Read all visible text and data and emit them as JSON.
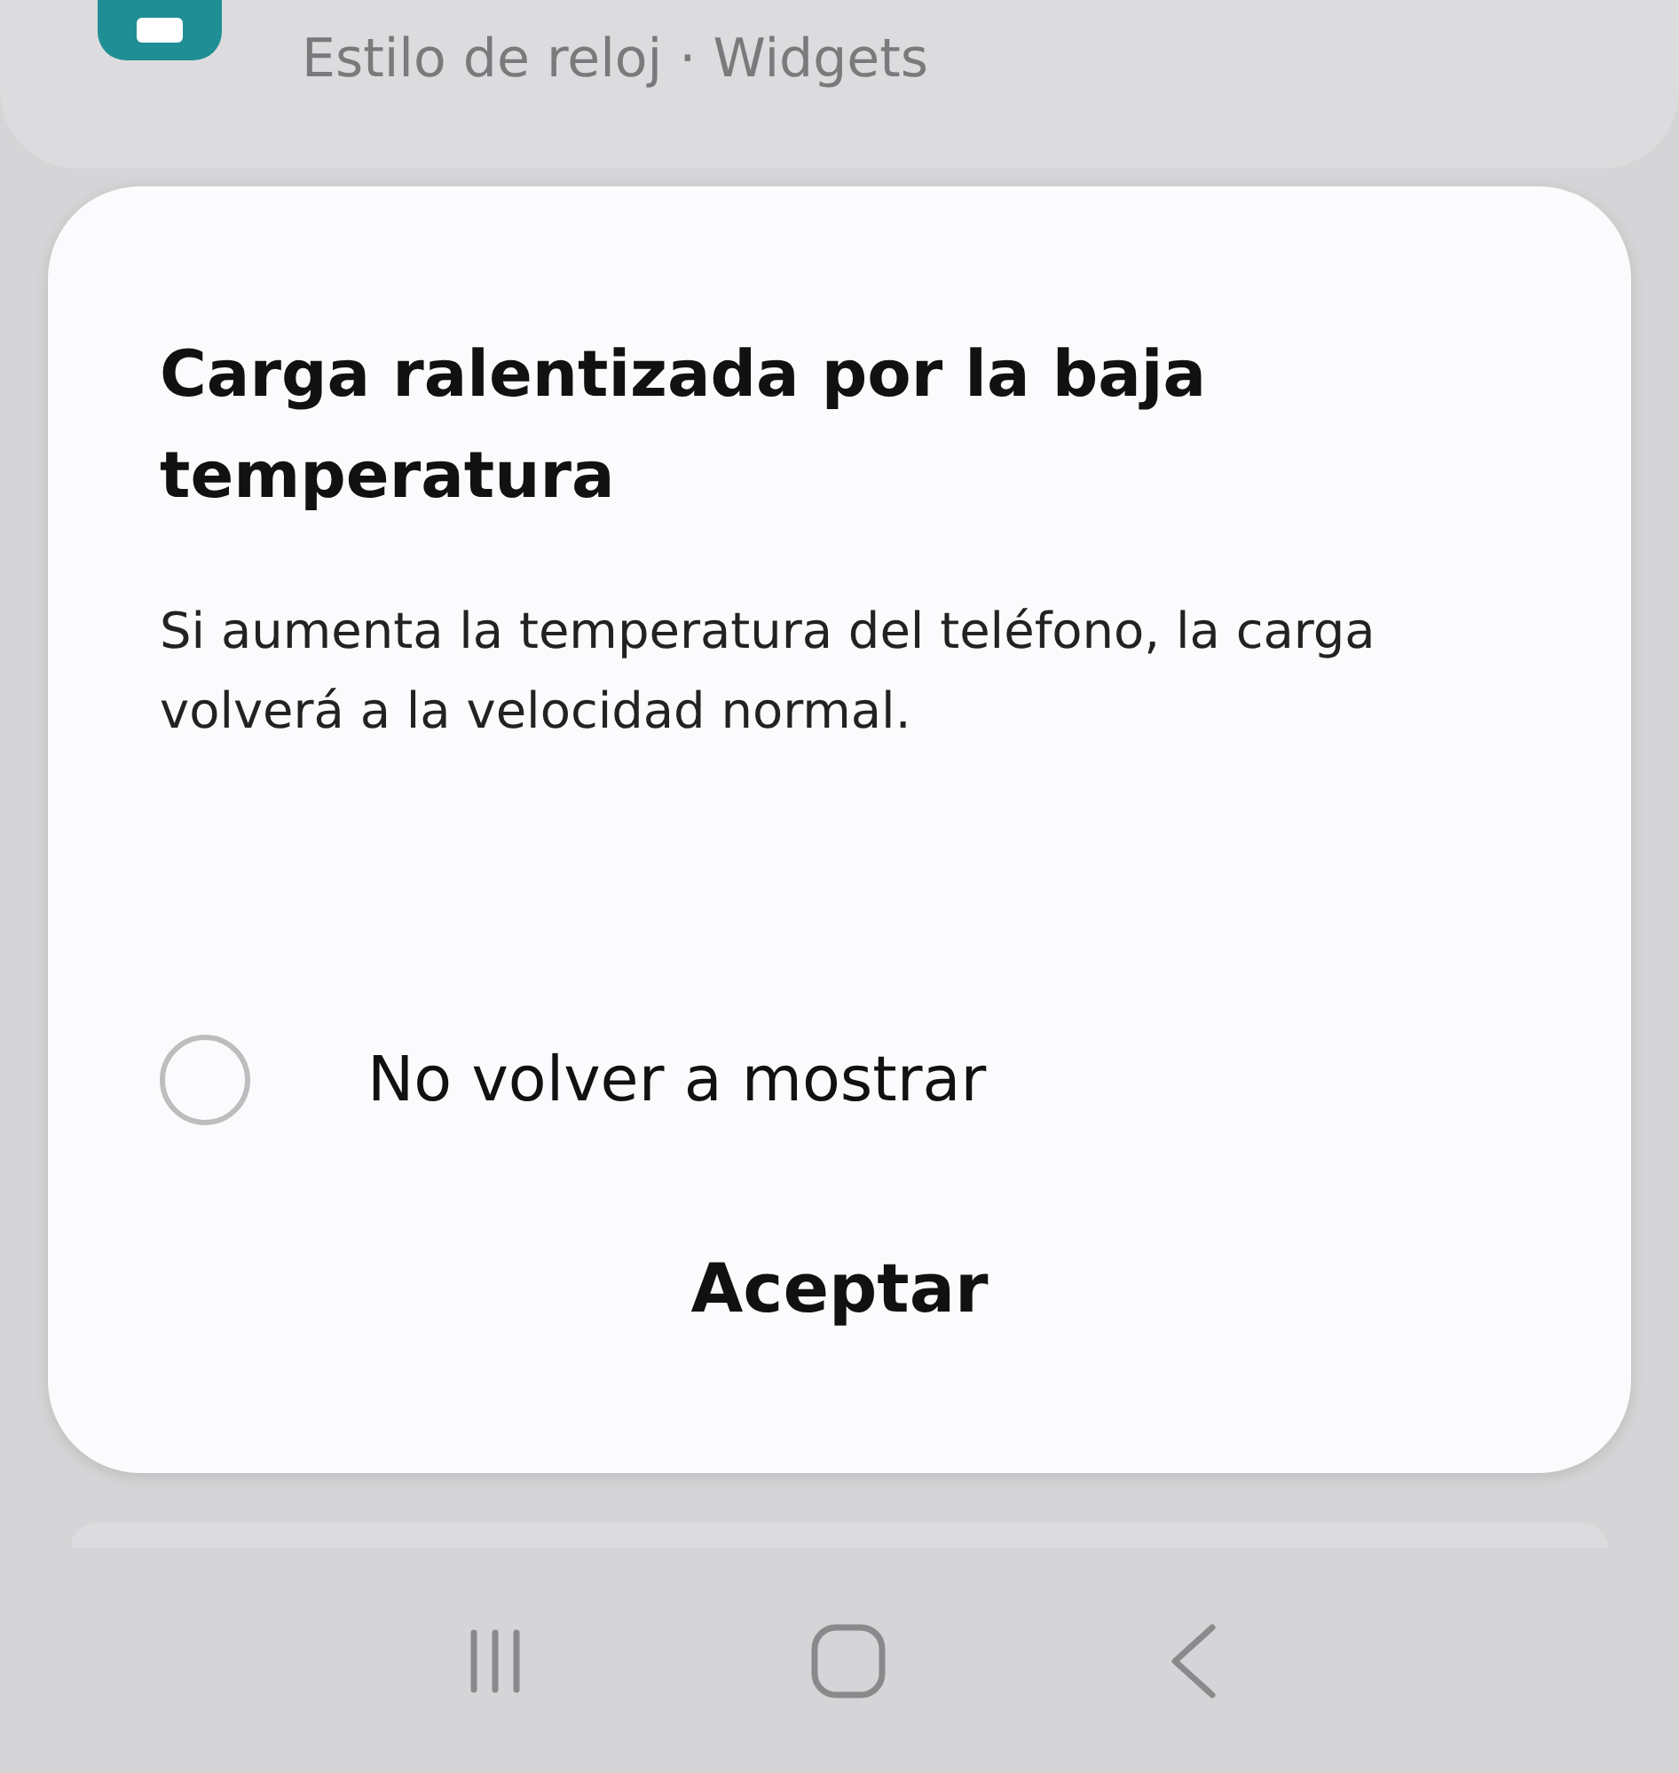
{
  "top_card": {
    "subtitle": "Estilo de reloj · Widgets"
  },
  "dialog": {
    "title": "Carga ralentizada por la baja temperatura",
    "message": "Si aumenta la temperatura del teléfono, la carga volverá a la velocidad normal.",
    "option": {
      "label": "No volver a mostrar",
      "checked": false
    },
    "button": "Aceptar"
  }
}
